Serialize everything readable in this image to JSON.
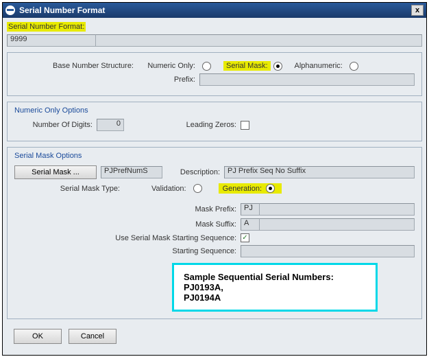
{
  "titlebar": {
    "title": "Serial Number Format",
    "close": "x"
  },
  "header": {
    "label": "Serial Number Format:",
    "value": "9999"
  },
  "structure": {
    "base_label": "Base Number Structure:",
    "numeric_label": "Numeric Only:",
    "serialmask_label": "Serial Mask:",
    "alpha_label": "Alphanumeric:",
    "prefix_label": "Prefix:",
    "prefix_value": ""
  },
  "numeric": {
    "title": "Numeric Only Options",
    "digits_label": "Number Of Digits:",
    "digits_value": "0",
    "leading_label": "Leading Zeros:"
  },
  "mask": {
    "title": "Serial Mask Options",
    "button": "Serial Mask ...",
    "code": "PJPrefNumS",
    "desc_label": "Description:",
    "desc_value": "PJ Prefix Seq No Suffix",
    "type_label": "Serial Mask Type:",
    "validation_label": "Validation:",
    "generation_label": "Generation:",
    "mask_prefix_label": "Mask Prefix:",
    "mask_prefix_value": "PJ",
    "mask_suffix_label": "Mask Suffix:",
    "mask_suffix_value": "A",
    "use_start_label": "Use Serial Mask Starting Sequence:",
    "use_start_check": "✓",
    "starting_seq_label": "Starting Sequence:",
    "starting_seq_value": ""
  },
  "callout": {
    "heading": "Sample Sequential Serial Numbers:",
    "line1": "PJ0193A,",
    "line2": "PJ0194A"
  },
  "buttons": {
    "ok": "OK",
    "cancel": "Cancel"
  }
}
